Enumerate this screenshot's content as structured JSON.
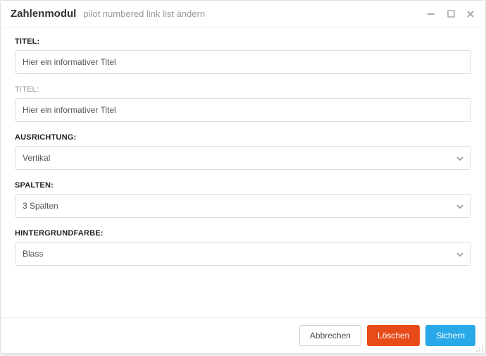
{
  "header": {
    "title": "Zahlenmodul",
    "subtitle": "pilot numbered link list ändern"
  },
  "fields": {
    "title1": {
      "label": "TITEL:",
      "value": "Hier ein informativer Titel"
    },
    "title2": {
      "label": "TITEL:",
      "value": "Hier ein informativer Titel"
    },
    "orientation": {
      "label": "AUSRICHTUNG:",
      "value": "Vertikal"
    },
    "columns": {
      "label": "SPALTEN:",
      "value": "3 Spalten"
    },
    "background": {
      "label": "HINTERGRUNDFARBE:",
      "value": "Blass"
    }
  },
  "footer": {
    "cancel": "Abbrechen",
    "delete": "Löschen",
    "save": "Sichern"
  }
}
